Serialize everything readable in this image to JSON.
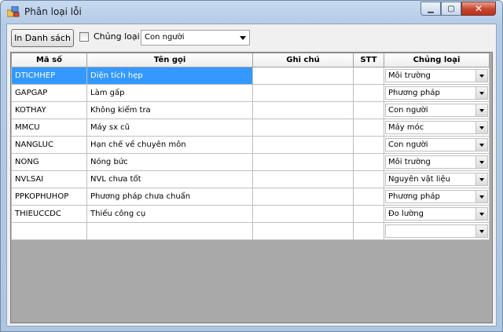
{
  "window": {
    "title": "Phân loại lỗi"
  },
  "toolbar": {
    "print_label": "In Danh sách",
    "checkbox_label": "Chủng loại",
    "checkbox_checked": false,
    "combo_value": "Con người"
  },
  "grid": {
    "columns": [
      "Mã số",
      "Tên gọi",
      "Ghi chú",
      "STT",
      "Chủng loại"
    ],
    "rows": [
      {
        "code": "DTICHHEP",
        "name": "Diện tích hẹp",
        "note": "",
        "stt": "",
        "type": "Môi trường",
        "selected": true
      },
      {
        "code": "GAPGAP",
        "name": "Làm gấp",
        "note": "",
        "stt": "",
        "type": "Phương pháp"
      },
      {
        "code": "KOTHAY",
        "name": "Không kiểm tra",
        "note": "",
        "stt": "",
        "type": "Con người"
      },
      {
        "code": "MMCU",
        "name": "Máy sx cũ",
        "note": "",
        "stt": "",
        "type": "Máy móc"
      },
      {
        "code": "NANGLUC",
        "name": "Hạn chế về chuyên môn",
        "note": "",
        "stt": "",
        "type": "Con người"
      },
      {
        "code": "NONG",
        "name": "Nóng bức",
        "note": "",
        "stt": "",
        "type": "Môi trường"
      },
      {
        "code": "NVLSAI",
        "name": "NVL chưa tốt",
        "note": "",
        "stt": "",
        "type": "Nguyên vật liệu"
      },
      {
        "code": "PPKOPHUHOP",
        "name": "Phương pháp chưa chuẩn",
        "note": "",
        "stt": "",
        "type": "Phương pháp"
      },
      {
        "code": "THIEUCCDC",
        "name": "Thiếu công cụ",
        "note": "",
        "stt": "",
        "type": "Đo lường"
      },
      {
        "code": "",
        "name": "",
        "note": "",
        "stt": "",
        "type": ""
      }
    ]
  }
}
